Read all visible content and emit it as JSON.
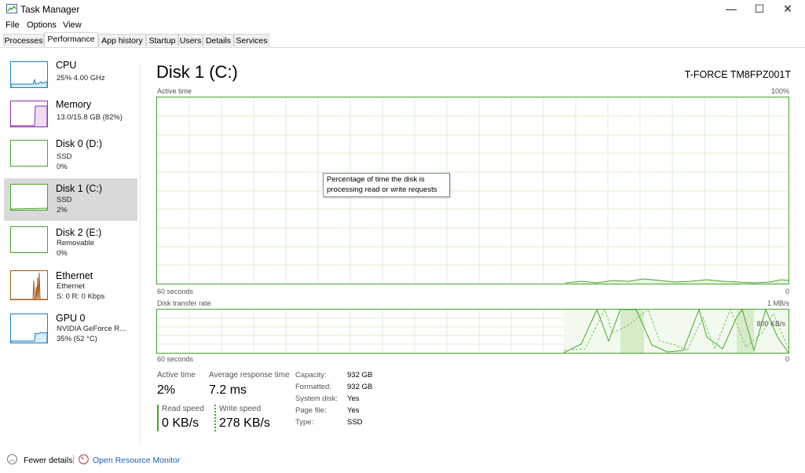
{
  "window": {
    "title": "Task Manager",
    "controls": {
      "minimize": "—",
      "maximize": "☐",
      "close": "✕"
    }
  },
  "menu": [
    "File",
    "Options",
    "View"
  ],
  "tabs": [
    "Processes",
    "Performance",
    "App history",
    "Startup",
    "Users",
    "Details",
    "Services"
  ],
  "active_tab": "Performance",
  "sidebar": [
    {
      "title": "CPU",
      "line1": "25%  4.00 GHz",
      "line2": "",
      "color": "#1a7fc4",
      "fill": "#d9ecf8"
    },
    {
      "title": "Memory",
      "line1": "13.0/15.8 GB (82%)",
      "line2": "",
      "color": "#8b2fa8",
      "fill": "#eedcf3"
    },
    {
      "title": "Disk 0 (D:)",
      "line1": "SSD",
      "line2": "0%",
      "color": "#4aa32e",
      "fill": "#eaf5e4"
    },
    {
      "title": "Disk 1 (C:)",
      "line1": "SSD",
      "line2": "2%",
      "color": "#4aa32e",
      "fill": "#eaf5e4",
      "selected": true
    },
    {
      "title": "Disk 2 (E:)",
      "line1": "Removable",
      "line2": "0%",
      "color": "#4aa32e",
      "fill": "#eaf5e4"
    },
    {
      "title": "Ethernet",
      "line1": "Ethernet",
      "line2": "S: 0  R: 0 Kbps",
      "color": "#a7591a",
      "fill": "#f5e6d8"
    },
    {
      "title": "GPU 0",
      "line1": "NVIDIA GeForce R...",
      "line2": "35%  (52 °C)",
      "color": "#1a7fc4",
      "fill": "#d9ecf8"
    }
  ],
  "main": {
    "title": "Disk 1 (C:)",
    "device": "T-FORCE TM8FPZ001T",
    "graph1": {
      "label": "Active time",
      "max": "100%",
      "time": "60 seconds",
      "min": "0"
    },
    "graph2": {
      "label": "Disk transfer rate",
      "max": "1 MB/s",
      "mid": "800 KB/s",
      "time": "60 seconds",
      "min": "0"
    },
    "tooltip": "Percentage of time the disk is processing read or write requests",
    "stats": {
      "active_time_label": "Active time",
      "active_time": "2%",
      "response_label": "Average response time",
      "response": "7.2 ms",
      "read_label": "Read speed",
      "read": "0 KB/s",
      "write_label": "Write speed",
      "write": "278 KB/s"
    },
    "capacity": {
      "labels": [
        "Capacity:",
        "Formatted:",
        "System disk:",
        "Page file:",
        "Type:"
      ],
      "values": [
        "932 GB",
        "932 GB",
        "Yes",
        "Yes",
        "SSD"
      ]
    }
  },
  "footer": {
    "fewer_details": "Fewer details",
    "open_monitor": "Open Resource Monitor"
  },
  "colors": {
    "disk_green": "#4aa32e",
    "grid_green": "#dcefd3",
    "link_blue": "#1a5fb4"
  }
}
